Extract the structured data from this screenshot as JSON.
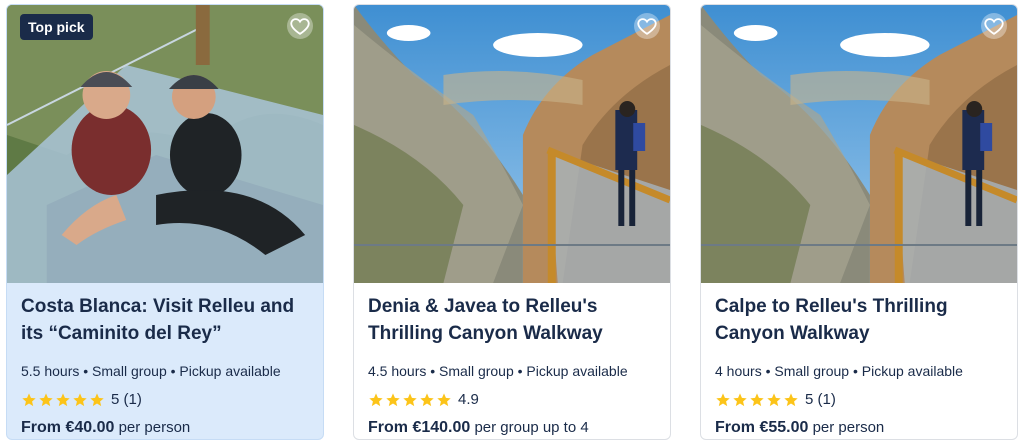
{
  "colors": {
    "star": "#fcc419",
    "text": "#1a2b49",
    "highlight_bg": "#dbeafb"
  },
  "cards": [
    {
      "badge": "Top pick",
      "title": "Costa Blanca: Visit Relleu and its “Caminito del Rey”",
      "meta": "5.5 hours • Small group • Pickup available",
      "rating_stars": 5,
      "rating_text": "5 (1)",
      "price_from": "From €40.00",
      "price_unit": "per person"
    },
    {
      "title": "Denia & Javea to Relleu's Thrilling Canyon Walkway",
      "meta": "4.5 hours • Small group • Pickup available",
      "rating_stars": 5,
      "rating_text": "4.9",
      "price_from": "From €140.00",
      "price_unit": "per group up to 4"
    },
    {
      "title": "Calpe to Relleu's Thrilling Canyon Walkway",
      "meta": "4 hours • Small group • Pickup available",
      "rating_stars": 5,
      "rating_text": "5 (1)",
      "price_from": "From €55.00",
      "price_unit": "per person"
    }
  ]
}
